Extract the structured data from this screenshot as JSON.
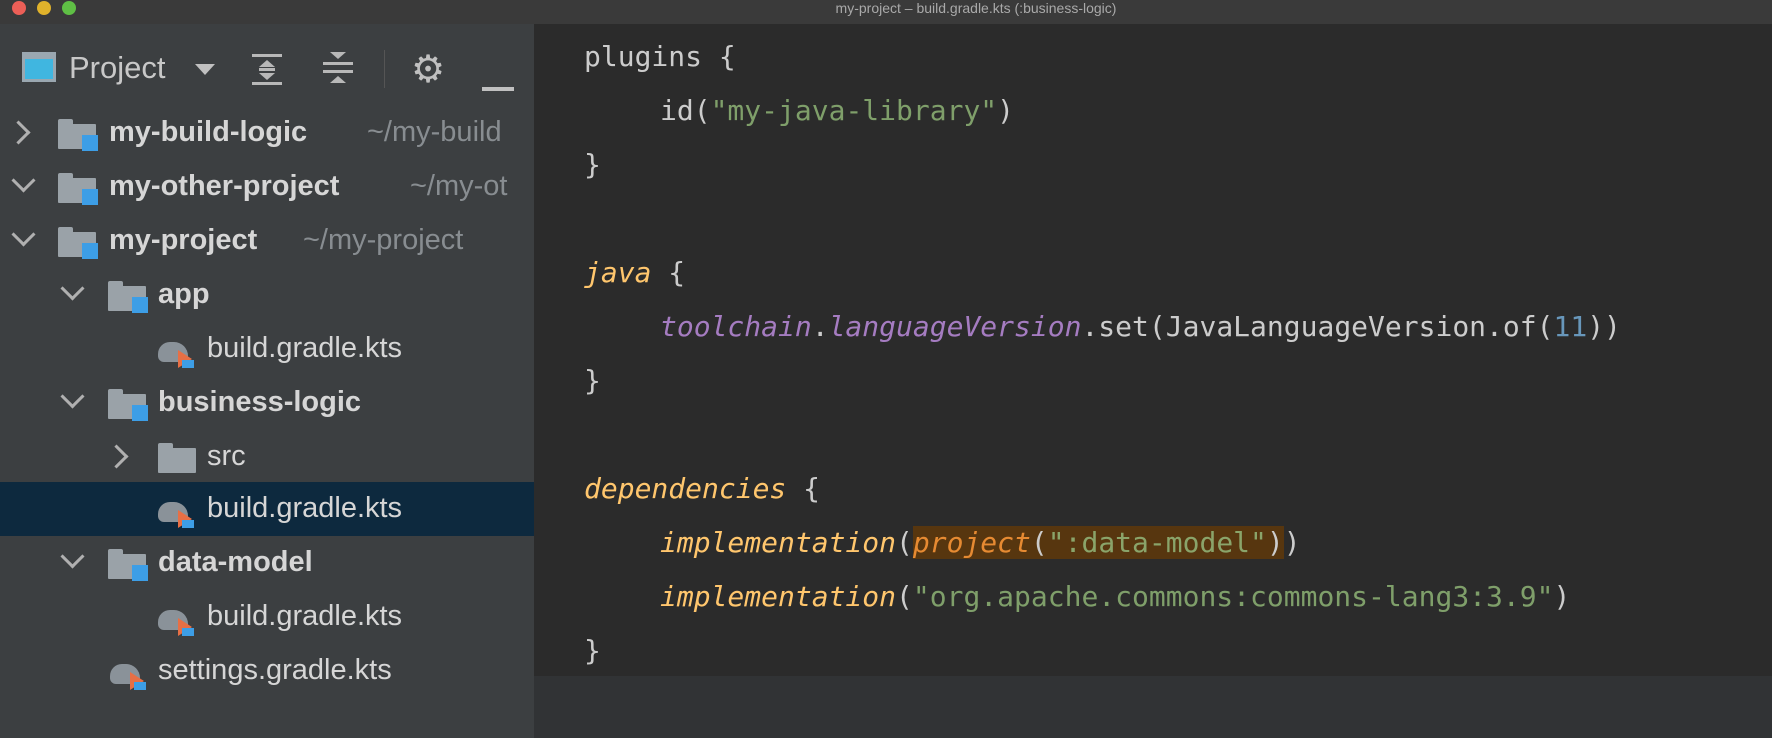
{
  "window": {
    "title": "my-project – build.gradle.kts (:business-logic)"
  },
  "panel": {
    "title": "Project",
    "icons": [
      "project-view-icon",
      "dropdown-icon",
      "expand-all-icon",
      "collapse-all-icon",
      "gear-icon",
      "minimize-icon"
    ]
  },
  "tree": [
    {
      "name": "my-build-logic",
      "path": "~/my-build",
      "expanded": false,
      "bold": true,
      "type": "module"
    },
    {
      "name": "my-other-project",
      "path": "~/my-ot",
      "expanded": true,
      "bold": true,
      "type": "module"
    },
    {
      "name": "my-project",
      "path": "~/my-project",
      "expanded": true,
      "bold": true,
      "type": "module"
    },
    {
      "name": "app",
      "expanded": true,
      "bold": true,
      "type": "module"
    },
    {
      "name": "build.gradle.kts",
      "type": "gradle-file"
    },
    {
      "name": "business-logic",
      "expanded": true,
      "bold": true,
      "type": "module"
    },
    {
      "name": "src",
      "expanded": false,
      "type": "folder"
    },
    {
      "name": "build.gradle.kts",
      "type": "gradle-file",
      "selected": true
    },
    {
      "name": "data-model",
      "expanded": true,
      "bold": true,
      "type": "module"
    },
    {
      "name": "build.gradle.kts",
      "type": "gradle-file"
    },
    {
      "name": "settings.gradle.kts",
      "type": "gradle-file"
    }
  ],
  "code": {
    "l1_plugins": "plugins",
    "l1_brace": " {",
    "l2_id": "id(",
    "l2_str": "\"my-java-library\"",
    "l2_close": ")",
    "l3": "}",
    "l5_java": "java",
    "l5_brace": " {",
    "l6_toolchain": "toolchain",
    "l6_dot": ".",
    "l6_langver": "languageVersion",
    "l6_set": ".set(JavaLanguageVersion.of(",
    "l6_num": "11",
    "l6_close": "))",
    "l7": "}",
    "l9_deps": "dependencies",
    "l9_brace": " {",
    "l10_impl": "implementation",
    "l10_open": "(",
    "l10_project": "project",
    "l10_paren": "(",
    "l10_str": "\":data-model\"",
    "l10_close1": ")",
    "l10_close2": ")",
    "l11_impl": "implementation",
    "l11_open": "(",
    "l11_str": "\"org.apache.commons:commons-lang3:3.9\"",
    "l11_close": ")",
    "l12": "}"
  },
  "colors": {
    "keyword": "#ffc66d",
    "string": "#7f9f6a",
    "property": "#a57cc1",
    "number": "#6897bb",
    "highlight_bg": "#57360f",
    "selection_bg": "#0d293e"
  }
}
